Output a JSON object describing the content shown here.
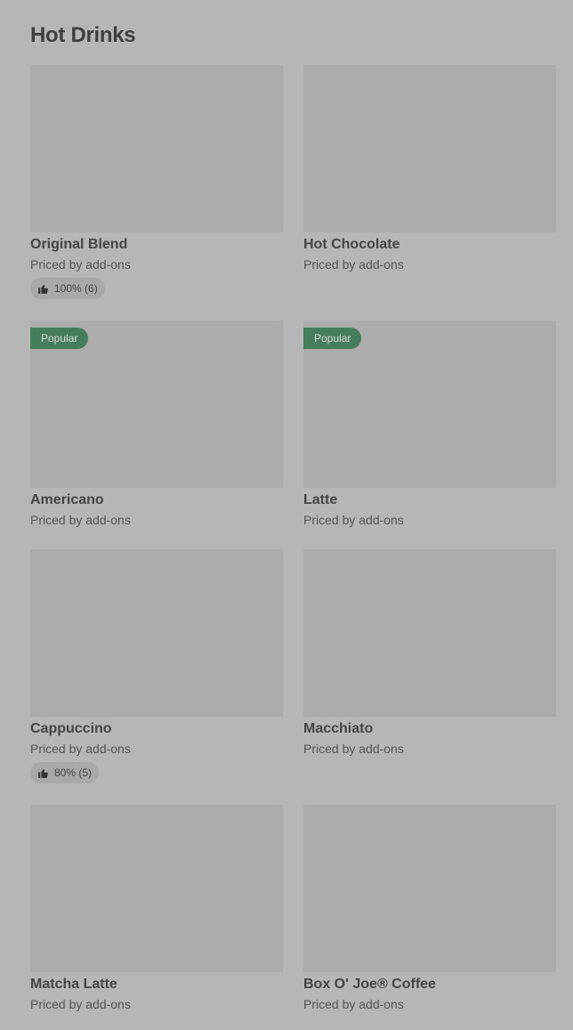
{
  "section": {
    "title": "Hot Drinks"
  },
  "items": [
    {
      "name": "Original Blend",
      "price": "Priced by add-ons",
      "rating": "100% (6)"
    },
    {
      "name": "Hot Chocolate",
      "price": "Priced by add-ons"
    },
    {
      "name": "Americano",
      "price": "Priced by add-ons",
      "badge": "Popular"
    },
    {
      "name": "Latte",
      "price": "Priced by add-ons",
      "badge": "Popular"
    },
    {
      "name": "Cappuccino",
      "price": "Priced by add-ons",
      "rating": "80% (5)"
    },
    {
      "name": "Macchiato",
      "price": "Priced by add-ons"
    },
    {
      "name": "Matcha Latte",
      "price": "Priced by add-ons"
    },
    {
      "name": "Box O' Joe® Coffee",
      "price": "Priced by add-ons"
    }
  ],
  "colors": {
    "badge_bg": "#467d5d",
    "placeholder": "#acacac",
    "page_bg": "#b6b6b6"
  },
  "icons": {
    "rating": "thumbs-up-icon"
  }
}
